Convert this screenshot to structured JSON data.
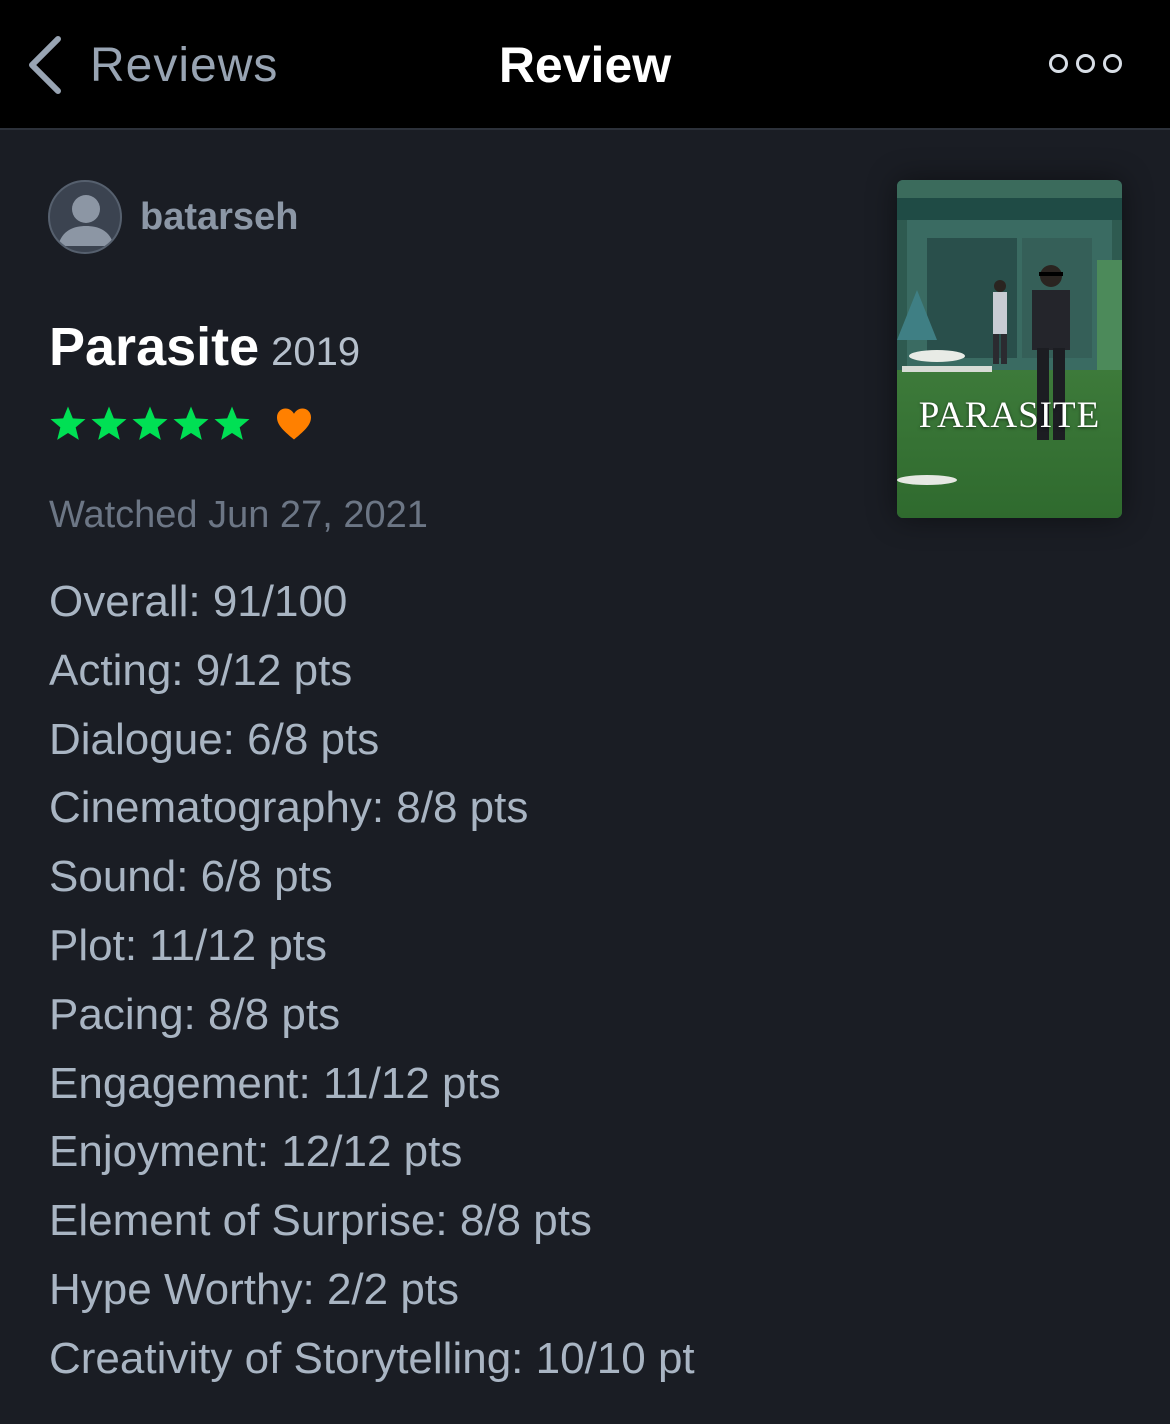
{
  "nav": {
    "back_label": "Reviews",
    "title": "Review"
  },
  "reviewer": {
    "username": "batarseh"
  },
  "film": {
    "title": "Parasite",
    "year": "2019",
    "poster_title": "PARASITE"
  },
  "rating": {
    "stars": 5,
    "liked": true
  },
  "watched": "Watched Jun 27, 2021",
  "scores": [
    "Overall: 91/100",
    "Acting: 9/12 pts",
    "Dialogue: 6/8 pts",
    "Cinematography: 8/8 pts",
    "Sound: 6/8 pts",
    "Plot: 11/12 pts",
    "Pacing: 8/8 pts",
    "Engagement: 11/12 pts",
    "Enjoyment: 12/12 pts",
    "Element of Surprise: 8/8 pts",
    "Hype Worthy: 2/2 pts",
    "Creativity of Storytelling: 10/10 pt"
  ],
  "icons": {
    "back": "chevron-left-icon",
    "more": "more-options-icon",
    "star": "star-icon",
    "heart": "heart-icon",
    "avatar": "avatar-placeholder-icon"
  },
  "colors": {
    "background": "#1a1d24",
    "topbar": "#000000",
    "star": "#00e054",
    "heart": "#ff8000",
    "score_text": "#a9b5c3"
  }
}
